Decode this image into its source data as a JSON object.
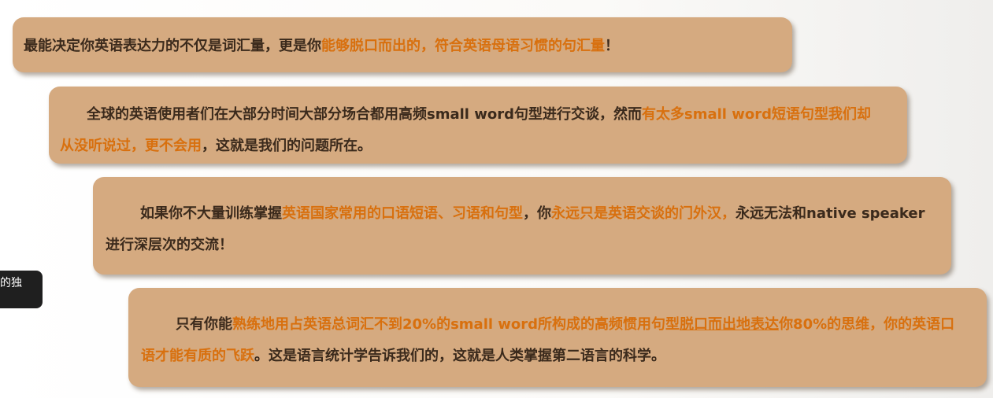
{
  "tooltip": {
    "text": "的独"
  },
  "paragraphs": [
    {
      "segments": [
        {
          "text": "最能决定你英语表达力的不仅是词汇量，更是你",
          "hl": false
        },
        {
          "text": "能够脱口而出的，符合英语母语习惯的句汇量",
          "hl": true
        },
        {
          "text": "！",
          "hl": false
        }
      ]
    },
    {
      "segments": [
        {
          "text": "全球的英语使用者们在大部分时间大部分场合都用高频small  word句型进行交谈，然而",
          "hl": false
        },
        {
          "text": "有太多small word短语句型我们却从没听说过，更不会用",
          "hl": true
        },
        {
          "text": "，这就是我们的问题所在。",
          "hl": false
        }
      ]
    },
    {
      "segments": [
        {
          "text": "如果你不大量训练掌握",
          "hl": false
        },
        {
          "text": "英语国家常用的口语短语、习语和句型",
          "hl": true
        },
        {
          "text": "，你",
          "hl": false
        },
        {
          "text": "永远只是英语交谈的门外汉，",
          "hl": true
        },
        {
          "text": "永远无法和native speaker进行深层次的交流！",
          "hl": false
        }
      ]
    },
    {
      "segments": [
        {
          "text": "只有你能",
          "hl": false
        },
        {
          "text": "熟练地用占英语总词汇不到20%的small  word所构成的高频惯用句型",
          "hl": true
        },
        {
          "text": "脱口而出地表达",
          "hl": true,
          "underline": true
        },
        {
          "text": "你80%的思维，你的英语口语才能有质的飞跃",
          "hl": true
        },
        {
          "text": "。这是语言统计学告诉我们的，这就是人类掌握第二语言的科学。",
          "hl": false
        }
      ]
    }
  ]
}
